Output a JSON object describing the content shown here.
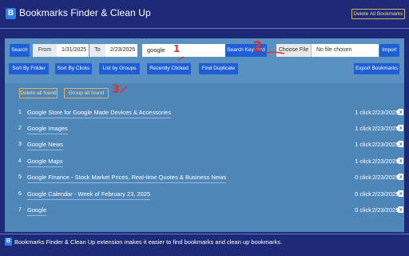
{
  "header": {
    "logo_letter": "B",
    "title": "Bookmarks Finder & Clean Up",
    "delete_all_label": "Delete All Bookmarks"
  },
  "toolbar": {
    "search_label": "Search",
    "from_label": "From",
    "from_value": "1/31/2025",
    "to_label": "To",
    "to_value": "2/23/2025",
    "search_value": "google",
    "search_keyword_label": "Search Keyword",
    "choose_file_label": "Choose File",
    "file_status": "No file chosen",
    "import_label": "Import",
    "sort_by_folder_label": "Sort By Folder",
    "sort_by_clicks_label": "Sort By Clicks",
    "list_by_groups_label": "List by Groups",
    "recently_clicked_label": "Recently Clicked",
    "find_duplicate_label": "Find Duplicate",
    "export_label": "Export Bookmarks"
  },
  "actions": {
    "delete_found_label": "Delete all found",
    "group_found_label": "Group all found"
  },
  "annotations": {
    "one": "1",
    "two": "2",
    "three": "3"
  },
  "results": [
    {
      "index": "1",
      "title": "Google Store for Google Made Devices & Accessories",
      "clicks": "1 click",
      "date": "2/23/2025"
    },
    {
      "index": "2",
      "title": "Google Images",
      "clicks": "1 click",
      "date": "2/23/2025"
    },
    {
      "index": "3",
      "title": "Google News",
      "clicks": "1 click",
      "date": "2/23/2025"
    },
    {
      "index": "4",
      "title": "Google Maps",
      "clicks": "1 click",
      "date": "2/23/2025"
    },
    {
      "index": "5",
      "title": "Google Finance - Stock Market Prices, Real-time Quotes & Business News",
      "clicks": "0 click",
      "date": "2/23/2025"
    },
    {
      "index": "6",
      "title": "Google Calendar - Week of February 23, 2025",
      "clicks": "0 click",
      "date": "2/23/2025"
    },
    {
      "index": "7",
      "title": "Google",
      "clicks": "0 click",
      "date": "2/23/2025"
    }
  ],
  "footer": {
    "logo_letter": "B",
    "text": "Bookmarks Finder & Clean Up extension makes it easier to find bookmarks and clean up bookmarks."
  },
  "colors": {
    "background": "#1d2a78",
    "panel": "#4f86b8",
    "button_blue": "#1f5fd6",
    "outline_gold": "#d9b56a",
    "annotation_red": "#e0302a"
  }
}
